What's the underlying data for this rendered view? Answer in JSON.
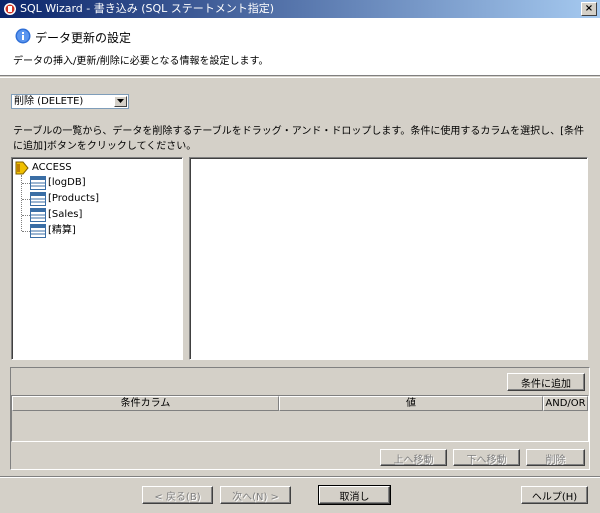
{
  "window": {
    "title": "SQL Wizard - 書き込み (SQL ステートメント指定)",
    "close_glyph": "×"
  },
  "header": {
    "heading": "データ更新の設定",
    "description": "データの挿入/更新/削除に必要となる情報を設定します。"
  },
  "operation": {
    "selected": "削除 (DELETE)"
  },
  "instruction": "テーブルの一覧から、データを削除するテーブルをドラッグ・アンド・ドロップします。条件に使用するカラムを選択し、[条件に追加]ボタンをクリックしてください。",
  "tree": {
    "root": "ACCESS",
    "items": [
      {
        "label": "[logDB]"
      },
      {
        "label": "[Products]"
      },
      {
        "label": "[Sales]"
      },
      {
        "label": "[精算]"
      }
    ]
  },
  "conditions": {
    "add_button": "条件に追加",
    "columns": [
      "条件カラム",
      "値",
      "AND/OR"
    ],
    "move_up_button": "上へ移動",
    "move_down_button": "下へ移動",
    "delete_button": "削除"
  },
  "footer": {
    "back_button": "< 戻る(B)",
    "next_button": "次へ(N) >",
    "cancel_button": "取消し",
    "help_button": "ヘルプ(H)"
  },
  "colors": {
    "titlebar_start": "#0a246a",
    "titlebar_end": "#a6caf0",
    "dialog_face": "#d4d0c8",
    "info_icon": "#2f6fd6",
    "db_icon": "#f0c000",
    "table_icon": "#3a6ea5"
  }
}
